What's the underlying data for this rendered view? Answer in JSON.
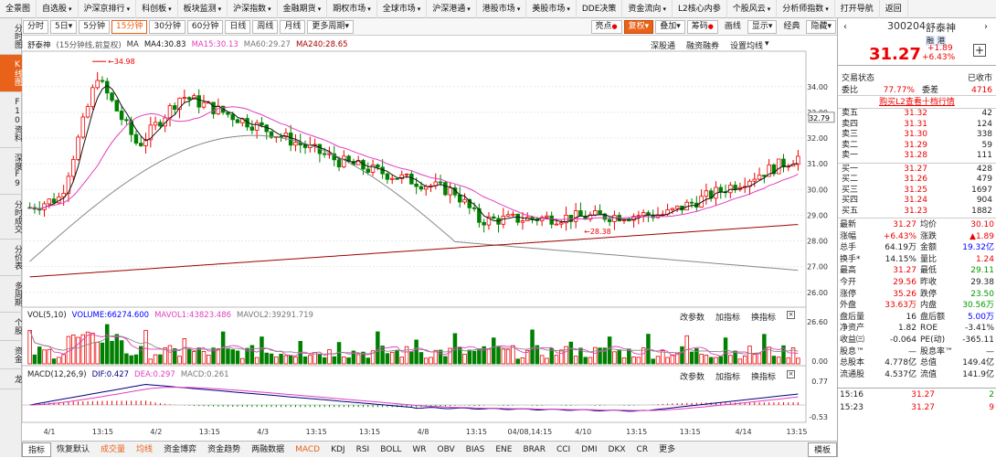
{
  "menubar": [
    {
      "label": "全景图",
      "chev": false
    },
    {
      "label": "自选股",
      "chev": true
    },
    {
      "label": "沪深京排行",
      "chev": true
    },
    {
      "label": "科创板",
      "chev": true
    },
    {
      "label": "板块监测",
      "chev": true
    },
    {
      "label": "沪深指数",
      "chev": true
    },
    {
      "label": "金融期货",
      "chev": true
    },
    {
      "label": "期权市场",
      "chev": true
    },
    {
      "label": "全球市场",
      "chev": true
    },
    {
      "label": "沪深港通",
      "chev": true
    },
    {
      "label": "港股市场",
      "chev": true
    },
    {
      "label": "美股市场",
      "chev": true
    },
    {
      "label": "DDE决策",
      "chev": false
    },
    {
      "label": "资金流向",
      "chev": true
    },
    {
      "label": "L2核心内参",
      "chev": false
    },
    {
      "label": "个股风云",
      "chev": true
    },
    {
      "label": "分析师指数",
      "chev": true
    },
    {
      "label": "打开导航",
      "chev": false
    },
    {
      "label": "返回",
      "chev": false
    }
  ],
  "leftbar": [
    {
      "label": "分时图",
      "active": false
    },
    {
      "label": "K线图",
      "active": true
    },
    {
      "label": "F10资料",
      "active": false
    },
    {
      "label": "深度F9",
      "active": false
    },
    {
      "label": "分时成交",
      "active": false
    },
    {
      "label": "分价表",
      "active": false
    },
    {
      "label": "多周期",
      "active": false
    },
    {
      "label": "个股",
      "active": false
    },
    {
      "label": "资金",
      "active": false
    },
    {
      "label": "龙",
      "active": false
    }
  ],
  "toolbar": {
    "periods": [
      {
        "label": "分时",
        "active": false
      },
      {
        "label": "5日",
        "chev": true,
        "active": false
      },
      {
        "label": "5分钟",
        "active": false
      },
      {
        "label": "15分钟",
        "active": true
      },
      {
        "label": "30分钟",
        "active": false
      },
      {
        "label": "60分钟",
        "active": false
      },
      {
        "label": "日线",
        "active": false
      },
      {
        "label": "周线",
        "active": false
      },
      {
        "label": "月线",
        "active": false
      },
      {
        "label": "更多周期",
        "chev": true,
        "active": false
      }
    ],
    "right": [
      {
        "label": "亮点",
        "dot": true
      },
      {
        "label": "复权",
        "chev": true,
        "orange": true
      },
      {
        "label": "叠加",
        "chev": true
      },
      {
        "label": "筹码",
        "dot": true
      },
      {
        "label": "画线",
        "plain": true
      },
      {
        "label": "显示",
        "chev": true
      },
      {
        "label": "经典",
        "plain": true
      },
      {
        "label": "隐藏",
        "chev": true
      }
    ]
  },
  "chart": {
    "name": "舒泰神",
    "period": "(15分钟线,前复权)",
    "ma": [
      {
        "label": "MA",
        "color": "#333"
      },
      {
        "label": "MA4:30.83",
        "color": "#111"
      },
      {
        "label": "MA15:30.13",
        "color": "#e040c0"
      },
      {
        "label": "MA60:29.27",
        "color": "#777"
      },
      {
        "label": "MA240:28.65",
        "color": "#a00"
      }
    ],
    "links": [
      "深股通",
      "融资融券",
      "设置均线"
    ],
    "price_ticks": [
      "34.00",
      "33.00",
      "32.00",
      "31.00",
      "30.00",
      "29.00",
      "28.00",
      "27.00",
      "26.00"
    ],
    "current_price": "32.79",
    "high_mark": "34.98",
    "low_mark": "28.38",
    "vol": {
      "label": "VOL(5,10)",
      "volume": "VOLUME:66274.600",
      "mavol1": "MAVOL1:43823.486",
      "mavol2": "MAVOL2:39291.719",
      "tick_top": "26.60",
      "tick_bottom": "0.00"
    },
    "macd": {
      "label": "MACD(12,26,9)",
      "dif": "DIF:0.427",
      "dea": "DEA:0.297",
      "macd": "MACD:0.261",
      "tick_top": "0.77",
      "tick_bottom": "-0.53"
    },
    "panel_links": [
      "改参数",
      "加指标",
      "换指标"
    ],
    "xlabels": [
      "4/1",
      "13:15",
      "4/2",
      "13:15",
      "4/3",
      "13:15",
      "13:15",
      "4/8",
      "13:15",
      "04/08,14:15",
      "4/10",
      "13:15",
      "13:15",
      "4/14",
      "13:15"
    ],
    "colors": {
      "up": "#e00",
      "down": "#008000",
      "ma4": "#111",
      "ma15": "#e040c0",
      "ma60": "#888",
      "ma240": "#a00000",
      "dif": "#000080",
      "dea": "#e040c0"
    }
  },
  "bottombar": [
    {
      "label": "指标",
      "first": true
    },
    {
      "label": "恢复默认"
    },
    {
      "label": "成交量",
      "active": true
    },
    {
      "label": "均线",
      "active": true
    },
    {
      "label": "资金博弈"
    },
    {
      "label": "资金趋势"
    },
    {
      "label": "两融数据"
    },
    {
      "label": "MACD",
      "active": true
    },
    {
      "label": "KDJ"
    },
    {
      "label": "RSI"
    },
    {
      "label": "BOLL"
    },
    {
      "label": "WR"
    },
    {
      "label": "OBV"
    },
    {
      "label": "BIAS"
    },
    {
      "label": "ENE"
    },
    {
      "label": "BRAR"
    },
    {
      "label": "CCI"
    },
    {
      "label": "DMI"
    },
    {
      "label": "DKX"
    },
    {
      "label": "CR"
    },
    {
      "label": "更多"
    },
    {
      "label": "模板",
      "chip": true
    }
  ],
  "quote": {
    "code": "300204",
    "name": "舒泰神",
    "tags": [
      "融",
      "港"
    ],
    "price": "31.27",
    "change": "+1.89",
    "pct": "+6.43%",
    "status_label": "交易状态",
    "status": "已收市",
    "weibi_label": "委比",
    "weibi": "77.77%",
    "weicha_label": "委差",
    "weicha": "4716",
    "l2_link": "购买L2查看十档行情",
    "sells": [
      {
        "label": "卖五",
        "price": "31.32",
        "vol": "42"
      },
      {
        "label": "卖四",
        "price": "31.31",
        "vol": "124"
      },
      {
        "label": "卖三",
        "price": "31.30",
        "vol": "338"
      },
      {
        "label": "卖二",
        "price": "31.29",
        "vol": "59"
      },
      {
        "label": "卖一",
        "price": "31.28",
        "vol": "111"
      }
    ],
    "buys": [
      {
        "label": "买一",
        "price": "31.27",
        "vol": "428"
      },
      {
        "label": "买二",
        "price": "31.26",
        "vol": "479"
      },
      {
        "label": "买三",
        "price": "31.25",
        "vol": "1697"
      },
      {
        "label": "买四",
        "price": "31.24",
        "vol": "904"
      },
      {
        "label": "买五",
        "price": "31.23",
        "vol": "1882"
      }
    ],
    "stats": [
      [
        "最新",
        "31.27",
        "red",
        "均价",
        "30.10",
        "red"
      ],
      [
        "涨幅",
        "+6.43%",
        "red",
        "涨跌",
        "▲1.89",
        "red"
      ],
      [
        "总手",
        "64.19万",
        "",
        "金额",
        "19.32亿",
        "blu"
      ],
      [
        "换手*",
        "14.15%",
        "",
        "量比",
        "1.24",
        "red"
      ],
      [
        "最高",
        "31.27",
        "red",
        "最低",
        "29.11",
        "grn"
      ],
      [
        "今开",
        "29.56",
        "red",
        "昨收",
        "29.38",
        ""
      ],
      [
        "涨停",
        "35.26",
        "red",
        "跌停",
        "23.50",
        "grn"
      ],
      [
        "外盘",
        "33.63万",
        "red",
        "内盘",
        "30.56万",
        "grn"
      ],
      [
        "盘后量",
        "16",
        "",
        "盘后额",
        "5.00万",
        "blu"
      ],
      [
        "净资产",
        "1.82",
        "",
        "ROE",
        "-3.41%",
        ""
      ],
      [
        "收益㈢",
        "-0.064",
        "",
        "PE(动)",
        "-365.11",
        ""
      ],
      [
        "股息™",
        "—",
        "",
        "股息率™",
        "—",
        ""
      ],
      [
        "总股本",
        "4.778亿",
        "",
        "总值",
        "149.4亿",
        ""
      ],
      [
        "流通股",
        "4.537亿",
        "",
        "流值",
        "141.9亿",
        ""
      ]
    ],
    "ticks": [
      {
        "time": "15:16",
        "price": "31.27",
        "vol": "2",
        "vcolor": "grn"
      },
      {
        "time": "15:23",
        "price": "31.27",
        "vol": "9",
        "vcolor": "red"
      }
    ]
  }
}
